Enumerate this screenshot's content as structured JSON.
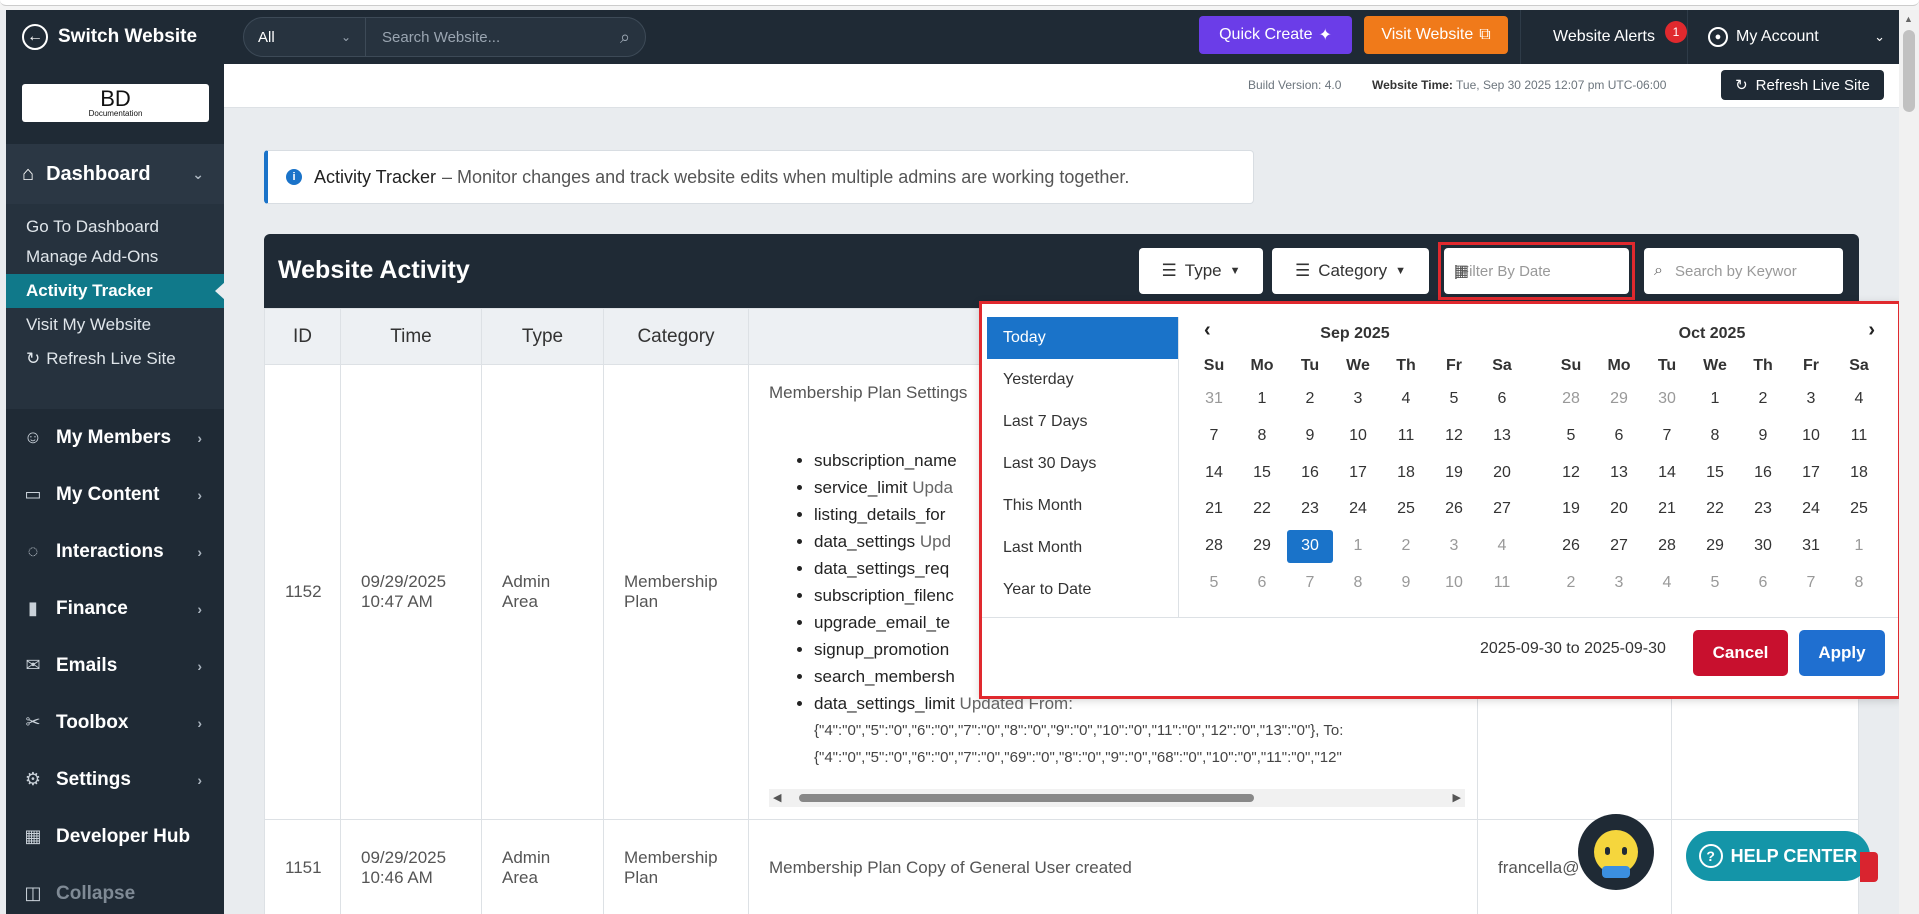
{
  "header": {
    "switch_label": "Switch Website",
    "search_scope": "All",
    "search_placeholder": "Search Website...",
    "quick_create": "Quick Create",
    "visit_website": "Visit Website",
    "alerts_label": "Website Alerts",
    "alerts_count": "1",
    "account_label": "My Account"
  },
  "sidebar": {
    "logo_main": "BD",
    "logo_sub": "Documentation",
    "dashboard": "Dashboard",
    "sub_items": [
      "Go To Dashboard",
      "Manage Add-Ons",
      "Activity Tracker",
      "Visit My Website",
      "Refresh Live Site"
    ],
    "items": [
      "My Members",
      "My Content",
      "Interactions",
      "Finance",
      "Emails",
      "Toolbox",
      "Settings",
      "Developer Hub",
      "Collapse"
    ]
  },
  "statusbar": {
    "build": "Build Version: 4.0",
    "time_label": "Website Time:",
    "time_value": "Tue, Sep 30 2025 12:07 pm UTC-06:00",
    "refresh": "Refresh Live Site"
  },
  "banner": {
    "title": "Activity Tracker",
    "text": "– Monitor changes and track website edits when multiple admins are working together."
  },
  "panel": {
    "title": "Website Activity",
    "type_btn": "Type",
    "category_btn": "Category",
    "date_placeholder": "Filter By Date",
    "keyword_placeholder": "Search by Keywor"
  },
  "table": {
    "columns": [
      "ID",
      "Time",
      "Type",
      "Category"
    ],
    "rows": [
      {
        "id": "1152",
        "time1": "09/29/2025",
        "time2": "10:47 AM",
        "type1": "Admin",
        "type2": "Area",
        "cat1": "Membership",
        "cat2": "Plan",
        "change_title": "Membership Plan Settings",
        "changes": [
          {
            "key": "subscription_name",
            "rest": ""
          },
          {
            "key": "service_limit",
            "rest": " Upda"
          },
          {
            "key": "listing_details_for",
            "rest": ""
          },
          {
            "key": "data_settings",
            "rest": " Upd"
          },
          {
            "key": "data_settings_req",
            "rest": ""
          },
          {
            "key": "subscription_filenc",
            "rest": ""
          },
          {
            "key": "upgrade_email_te",
            "rest": ""
          },
          {
            "key": "signup_promotion",
            "rest": ""
          },
          {
            "key": "search_membersh",
            "rest": ""
          },
          {
            "key": "data_settings_limit",
            "rest": " Updated From:"
          }
        ],
        "json1": "{\"4\":\"0\",\"5\":\"0\",\"6\":\"0\",\"7\":\"0\",\"8\":\"0\",\"9\":\"0\",\"10\":\"0\",\"11\":\"0\",\"12\":\"0\",\"13\":\"0\"}, To:",
        "json2": "{\"4\":\"0\",\"5\":\"0\",\"6\":\"0\",\"7\":\"0\",\"69\":\"0\",\"8\":\"0\",\"9\":\"0\",\"68\":\"0\",\"10\":\"0\",\"11\":\"0\",\"12\""
      },
      {
        "id": "1151",
        "time1": "09/29/2025",
        "time2": "10:46 AM",
        "type1": "Admin",
        "type2": "Area",
        "cat1": "Membership",
        "cat2": "Plan",
        "change_title": "Membership Plan Copy of General User created",
        "user": "francella@"
      }
    ]
  },
  "datepicker": {
    "ranges": [
      "Today",
      "Yesterday",
      "Last 7 Days",
      "Last 30 Days",
      "This Month",
      "Last Month",
      "Year to Date"
    ],
    "active_range": "Today",
    "left_month": "Sep 2025",
    "right_month": "Oct 2025",
    "dow": [
      "Su",
      "Mo",
      "Tu",
      "We",
      "Th",
      "Fr",
      "Sa"
    ],
    "left_days": [
      [
        "31",
        "off"
      ],
      [
        "1",
        ""
      ],
      [
        "2",
        ""
      ],
      [
        "3",
        ""
      ],
      [
        "4",
        ""
      ],
      [
        "5",
        ""
      ],
      [
        "6",
        ""
      ],
      [
        "7",
        ""
      ],
      [
        "8",
        ""
      ],
      [
        "9",
        ""
      ],
      [
        "10",
        ""
      ],
      [
        "11",
        ""
      ],
      [
        "12",
        ""
      ],
      [
        "13",
        ""
      ],
      [
        "14",
        ""
      ],
      [
        "15",
        ""
      ],
      [
        "16",
        ""
      ],
      [
        "17",
        ""
      ],
      [
        "18",
        ""
      ],
      [
        "19",
        ""
      ],
      [
        "20",
        ""
      ],
      [
        "21",
        ""
      ],
      [
        "22",
        ""
      ],
      [
        "23",
        ""
      ],
      [
        "24",
        ""
      ],
      [
        "25",
        ""
      ],
      [
        "26",
        ""
      ],
      [
        "27",
        ""
      ],
      [
        "28",
        ""
      ],
      [
        "29",
        ""
      ],
      [
        "30",
        "sel"
      ],
      [
        "1",
        "off"
      ],
      [
        "2",
        "off"
      ],
      [
        "3",
        "off"
      ],
      [
        "4",
        "off"
      ],
      [
        "5",
        "off"
      ],
      [
        "6",
        "off"
      ],
      [
        "7",
        "off"
      ],
      [
        "8",
        "off"
      ],
      [
        "9",
        "off"
      ],
      [
        "10",
        "off"
      ],
      [
        "11",
        "off"
      ]
    ],
    "right_days": [
      [
        "28",
        "off"
      ],
      [
        "29",
        "off"
      ],
      [
        "30",
        "off"
      ],
      [
        "1",
        ""
      ],
      [
        "2",
        ""
      ],
      [
        "3",
        ""
      ],
      [
        "4",
        ""
      ],
      [
        "5",
        ""
      ],
      [
        "6",
        ""
      ],
      [
        "7",
        ""
      ],
      [
        "8",
        ""
      ],
      [
        "9",
        ""
      ],
      [
        "10",
        ""
      ],
      [
        "11",
        ""
      ],
      [
        "12",
        ""
      ],
      [
        "13",
        ""
      ],
      [
        "14",
        ""
      ],
      [
        "15",
        ""
      ],
      [
        "16",
        ""
      ],
      [
        "17",
        ""
      ],
      [
        "18",
        ""
      ],
      [
        "19",
        ""
      ],
      [
        "20",
        ""
      ],
      [
        "21",
        ""
      ],
      [
        "22",
        ""
      ],
      [
        "23",
        ""
      ],
      [
        "24",
        ""
      ],
      [
        "25",
        ""
      ],
      [
        "26",
        ""
      ],
      [
        "27",
        ""
      ],
      [
        "28",
        ""
      ],
      [
        "29",
        ""
      ],
      [
        "30",
        ""
      ],
      [
        "31",
        ""
      ],
      [
        "1",
        "off"
      ],
      [
        "2",
        "off"
      ],
      [
        "3",
        "off"
      ],
      [
        "4",
        "off"
      ],
      [
        "5",
        "off"
      ],
      [
        "6",
        "off"
      ],
      [
        "7",
        "off"
      ],
      [
        "8",
        "off"
      ]
    ],
    "range_text": "2025-09-30 to 2025-09-30",
    "cancel": "Cancel",
    "apply": "Apply"
  },
  "help": {
    "label": "HELP CENTER"
  }
}
